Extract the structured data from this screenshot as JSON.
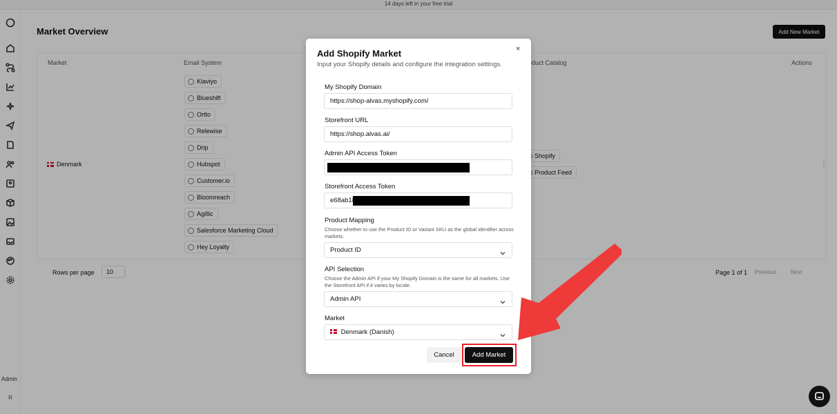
{
  "banner": {
    "text": "14 days left in your free trial"
  },
  "sidebar": {
    "admin_label": "Admin",
    "avatar_initial": "R"
  },
  "page": {
    "title": "Market Overview",
    "add_new_market": "Add New Market",
    "columns": {
      "market": "Market",
      "email_system": "Email System",
      "product_catalog": "Product Catalog",
      "actions": "Actions"
    },
    "row": {
      "market": "Denmark",
      "email_systems": [
        "Klaviyo",
        "Blueshift",
        "Ortto",
        "Relewise",
        "Drip",
        "Hubspot",
        "Customer.io",
        "Bloomreach",
        "Agillic",
        "Salesforce Marketing Cloud",
        "Hey Loyalty"
      ],
      "catalogs": [
        "Shopify",
        "Product Feed"
      ],
      "actions": "⋮"
    },
    "pagination": {
      "rows_per_page_label": "Rows per page",
      "rows_per_page_value": "10",
      "page_info": "Page 1 of 1",
      "previous": "Previous",
      "next": "Next"
    }
  },
  "modal": {
    "title": "Add Shopify Market",
    "subtitle": "Input your Shopify details and configure the integration settings.",
    "close": "×",
    "fields": {
      "domain": {
        "label": "My Shopify Domain",
        "value": "https://shop-alvas.myshopify.com/"
      },
      "storefront_url": {
        "label": "Storefront URL",
        "value": "https://shop.alvas.ai/"
      },
      "admin_token": {
        "label": "Admin API Access Token",
        "value": ""
      },
      "storefront_token": {
        "label": "Storefront Access Token",
        "value": "e68ab18"
      },
      "product_mapping": {
        "label": "Product Mapping",
        "help": "Choose whether to use the Product ID or Variant SKU as the global identifier across markets.",
        "value": "Product ID"
      },
      "api_selection": {
        "label": "API Selection",
        "help": "Choose the Admin API if your My Shopify Domain is the same for all markets. Use the Storefront API if it varies by locale.",
        "value": "Admin API"
      },
      "market": {
        "label": "Market",
        "value": "Denmark (Danish)",
        "flag": "🇩🇰"
      }
    },
    "cancel": "Cancel",
    "submit": "Add Market"
  },
  "colors": {
    "accent": "#111111",
    "highlight": "#e8202a",
    "overlay": "rgba(0,0,0,0.30)"
  }
}
